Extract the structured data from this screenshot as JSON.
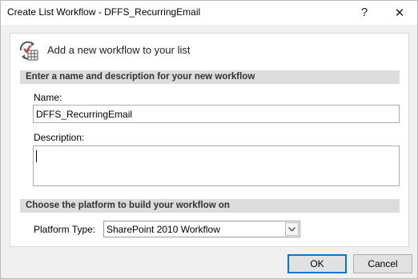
{
  "window": {
    "title": "Create List Workflow - DFFS_RecurringEmail",
    "help_glyph": "?",
    "close_glyph": "✕"
  },
  "header": {
    "icon": "workflow-icon",
    "text": "Add a new workflow to your list"
  },
  "section_name": {
    "heading": "Enter a name and description for your new workflow",
    "name_label": "Name:",
    "name_value": "DFFS_RecurringEmail",
    "description_label": "Description:",
    "description_value": ""
  },
  "section_platform": {
    "heading": "Choose the platform to build your workflow on",
    "platform_label": "Platform Type:",
    "platform_value": "SharePoint 2010 Workflow"
  },
  "buttons": {
    "ok": "OK",
    "cancel": "Cancel"
  },
  "colors": {
    "accent": "#0078d7",
    "section_bg": "#dcdcdc",
    "icon_red": "#d13438"
  }
}
